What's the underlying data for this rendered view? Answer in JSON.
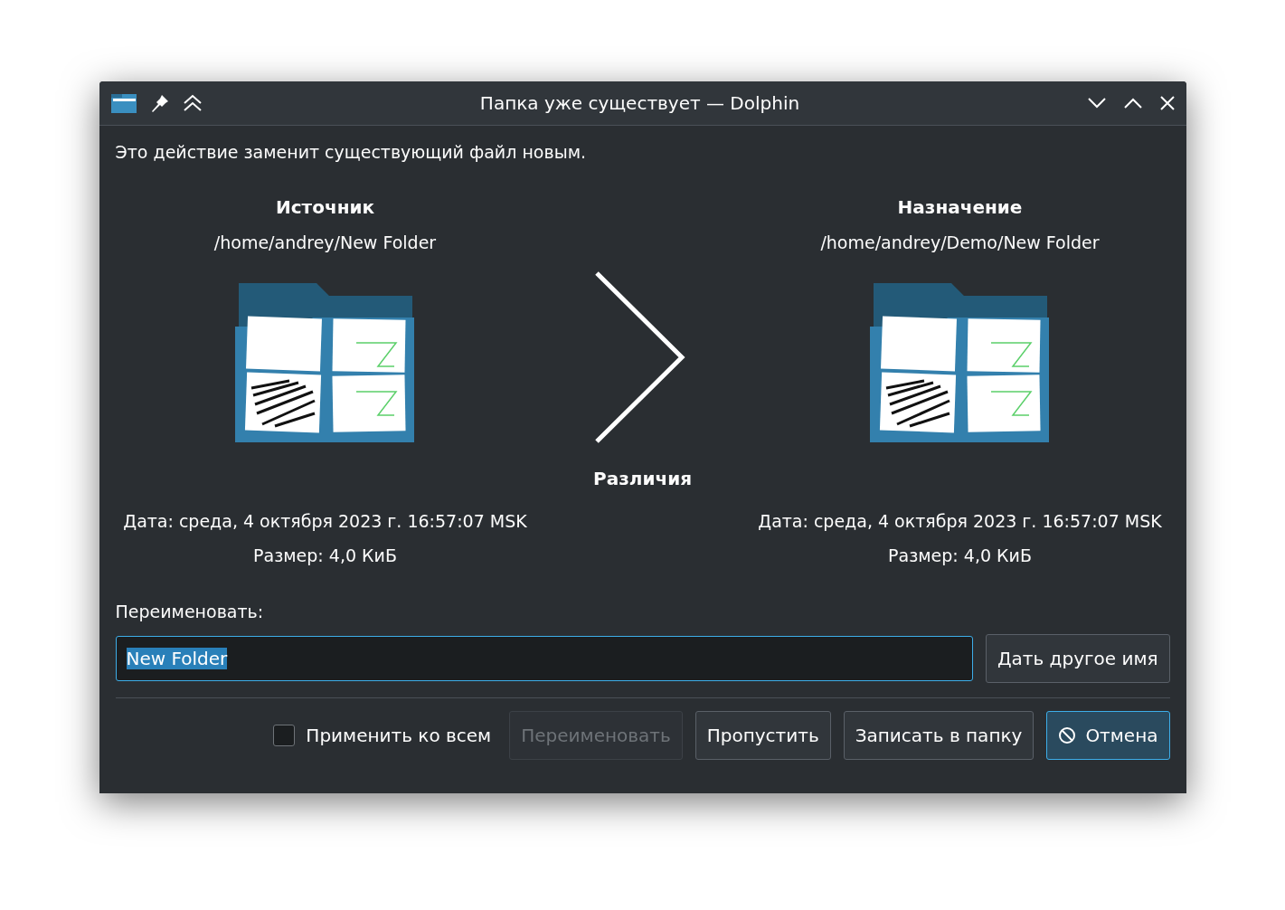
{
  "window": {
    "title": "Папка уже существует — Dolphin"
  },
  "message": "Это действие заменит существующий файл новым.",
  "panels": [
    {
      "heading": "Источник",
      "path": "/home/andrey/New Folder",
      "date": "Дата: среда, 4 октября 2023 г. 16:57:07 MSK",
      "size": "Размер: 4,0 КиБ"
    },
    {
      "heading": "Назначение",
      "path": "/home/andrey/Demo/New Folder",
      "date": "Дата: среда, 4 октября 2023 г. 16:57:07 MSK",
      "size": "Размер: 4,0 КиБ"
    }
  ],
  "differences_label": "Различия",
  "rename": {
    "label": "Переименовать:",
    "value": "New Folder",
    "value_selected": true,
    "suggest_button": "Дать другое имя"
  },
  "apply_to_all": {
    "label": "Применить ко всем",
    "checked": false
  },
  "buttons": [
    {
      "label": "Переименовать",
      "kind": "plain",
      "disabled": true,
      "default": false
    },
    {
      "label": "Пропустить",
      "kind": "plain",
      "disabled": false,
      "default": false
    },
    {
      "label": "Записать в папку",
      "kind": "plain",
      "disabled": false,
      "default": false
    },
    {
      "label": "Отмена",
      "kind": "cancel",
      "disabled": false,
      "default": true
    }
  ]
}
